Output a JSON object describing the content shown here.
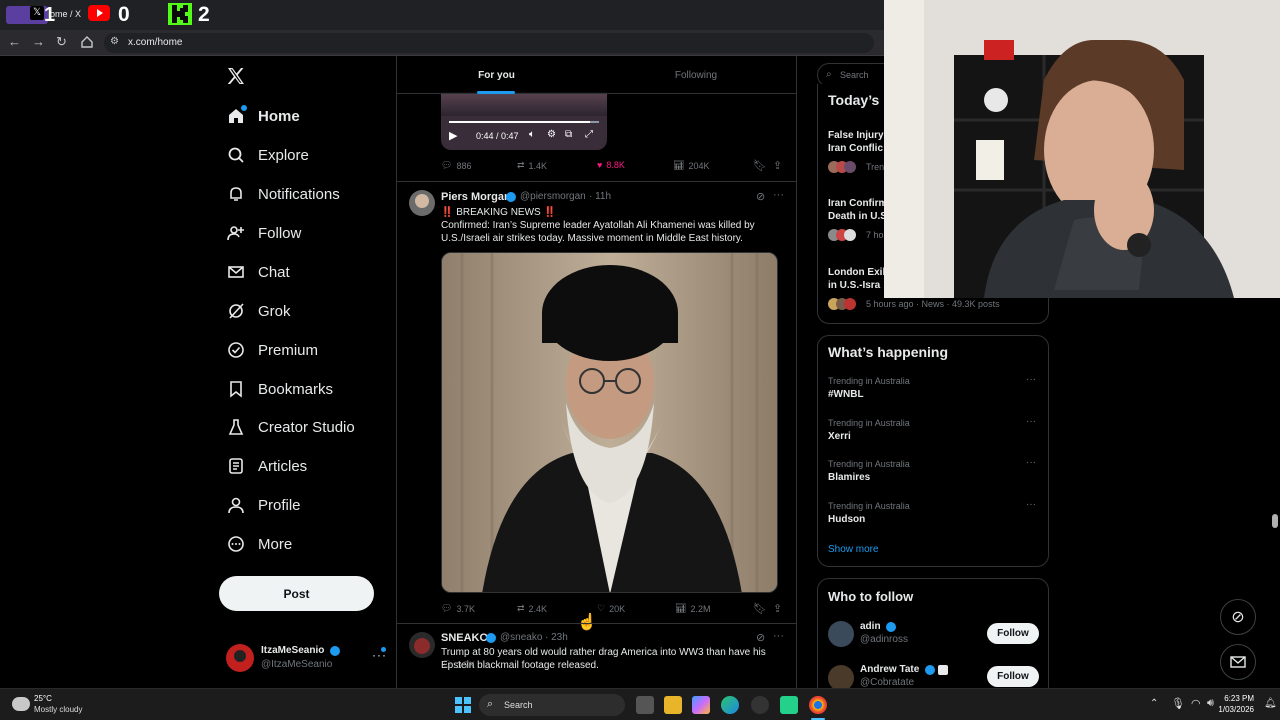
{
  "browser": {
    "tab_label": "ome / X",
    "overlay_counts": {
      "first": "1",
      "youtube": "0",
      "kick": "2"
    },
    "url": "x.com/home"
  },
  "nav": {
    "items": [
      {
        "label": "Home",
        "icon": "home-icon"
      },
      {
        "label": "Explore",
        "icon": "search-icon"
      },
      {
        "label": "Notifications",
        "icon": "bell-icon"
      },
      {
        "label": "Follow",
        "icon": "person-plus-icon"
      },
      {
        "label": "Chat",
        "icon": "mail-icon"
      },
      {
        "label": "Grok",
        "icon": "grok-icon"
      },
      {
        "label": "Premium",
        "icon": "verified-icon"
      },
      {
        "label": "Bookmarks",
        "icon": "bookmark-icon"
      },
      {
        "label": "Creator Studio",
        "icon": "flask-icon"
      },
      {
        "label": "Articles",
        "icon": "article-icon"
      },
      {
        "label": "Profile",
        "icon": "person-icon"
      },
      {
        "label": "More",
        "icon": "more-circle-icon"
      }
    ],
    "post_label": "Post",
    "account": {
      "name": "ItzaMeSeanio",
      "handle": "@ItzaMeSeanio"
    }
  },
  "feed": {
    "tabs": [
      {
        "label": "For you"
      },
      {
        "label": "Following"
      }
    ],
    "video_time": "0:44 / 0:47",
    "prev_actions": {
      "replies": "886",
      "reposts": "1.4K",
      "likes": "8.8K",
      "views": "204K"
    },
    "tweets": [
      {
        "name": "Piers Morgan",
        "handle": "@piersmorgan",
        "time": "· 11h",
        "line1": "‼️ BREAKING NEWS ‼️",
        "text": "Confirmed: Iran’s Supreme leader Ayatollah Ali Khamenei was killed by U.S./Israeli air strikes today. Massive moment in Middle East history.",
        "actions": {
          "replies": "3.7K",
          "reposts": "2.4K",
          "likes": "20K",
          "views": "2.2M"
        }
      },
      {
        "name": "SNEAKO",
        "handle": "@sneako",
        "time": "· 23h",
        "text": "Trump at 80 years old would rather drag America into WW3 than have his Epstein blackmail footage released."
      }
    ]
  },
  "right": {
    "search_placeholder": "Search",
    "todays_news": {
      "title": "Today’s",
      "items": [
        {
          "headline": "False Injury\nIran Conflic",
          "meta": "Tren"
        },
        {
          "headline": "Iran Confirm\nDeath in U.S",
          "meta": "7 ho"
        },
        {
          "headline": "London Exil\nin U.S.-Isra",
          "meta": "5 hours ago · News · 49.3K posts"
        }
      ]
    },
    "happening": {
      "title": "What’s happening",
      "trends": [
        {
          "context": "Trending in Australia",
          "name": "#WNBL"
        },
        {
          "context": "Trending in Australia",
          "name": "Xerri"
        },
        {
          "context": "Trending in Australia",
          "name": "Blamires"
        },
        {
          "context": "Trending in Australia",
          "name": "Hudson"
        }
      ],
      "show_more": "Show more"
    },
    "who_to_follow": {
      "title": "Who to follow",
      "users": [
        {
          "name": "adin",
          "handle": "@adinross",
          "button": "Follow"
        },
        {
          "name": "Andrew Tate",
          "handle": "@Cobratate",
          "button": "Follow"
        }
      ]
    }
  },
  "taskbar": {
    "weather_temp": "25°C",
    "weather_desc": "Mostly cloudy",
    "search_label": "Search",
    "time": "6:23 PM",
    "date": "1/03/2026"
  },
  "colors": {
    "accent": "#1d9bf0",
    "like_active": "#f91880",
    "verified": "#1d9bf0"
  }
}
